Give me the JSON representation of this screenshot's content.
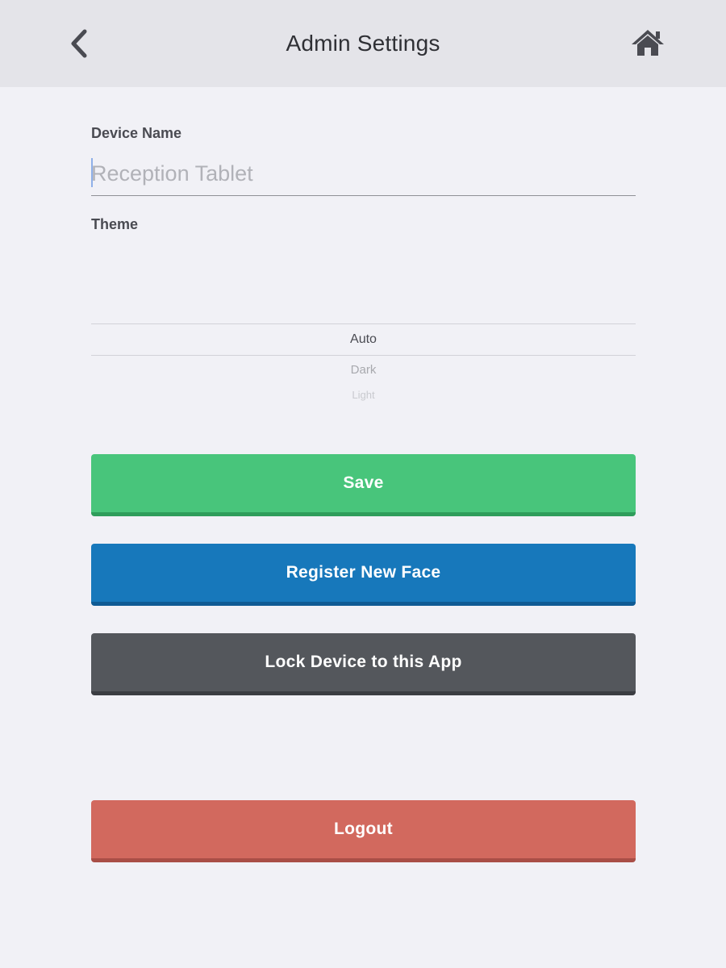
{
  "header": {
    "title": "Admin Settings",
    "back_icon": "chevron-left-icon",
    "home_icon": "home-icon"
  },
  "form": {
    "device_name": {
      "label": "Device Name",
      "value": "",
      "placeholder": "Reception Tablet"
    },
    "theme": {
      "label": "Theme",
      "options": [
        "Auto",
        "Dark",
        "Light"
      ],
      "selected": "Auto"
    }
  },
  "buttons": {
    "save": "Save",
    "register": "Register New Face",
    "lock": "Lock Device to this App",
    "logout": "Logout"
  },
  "colors": {
    "save": "#48c57b",
    "register": "#1778bb",
    "lock": "#54575c",
    "logout": "#d2695e",
    "header_bg": "#e4e4e9",
    "page_bg": "#f1f1f6"
  }
}
